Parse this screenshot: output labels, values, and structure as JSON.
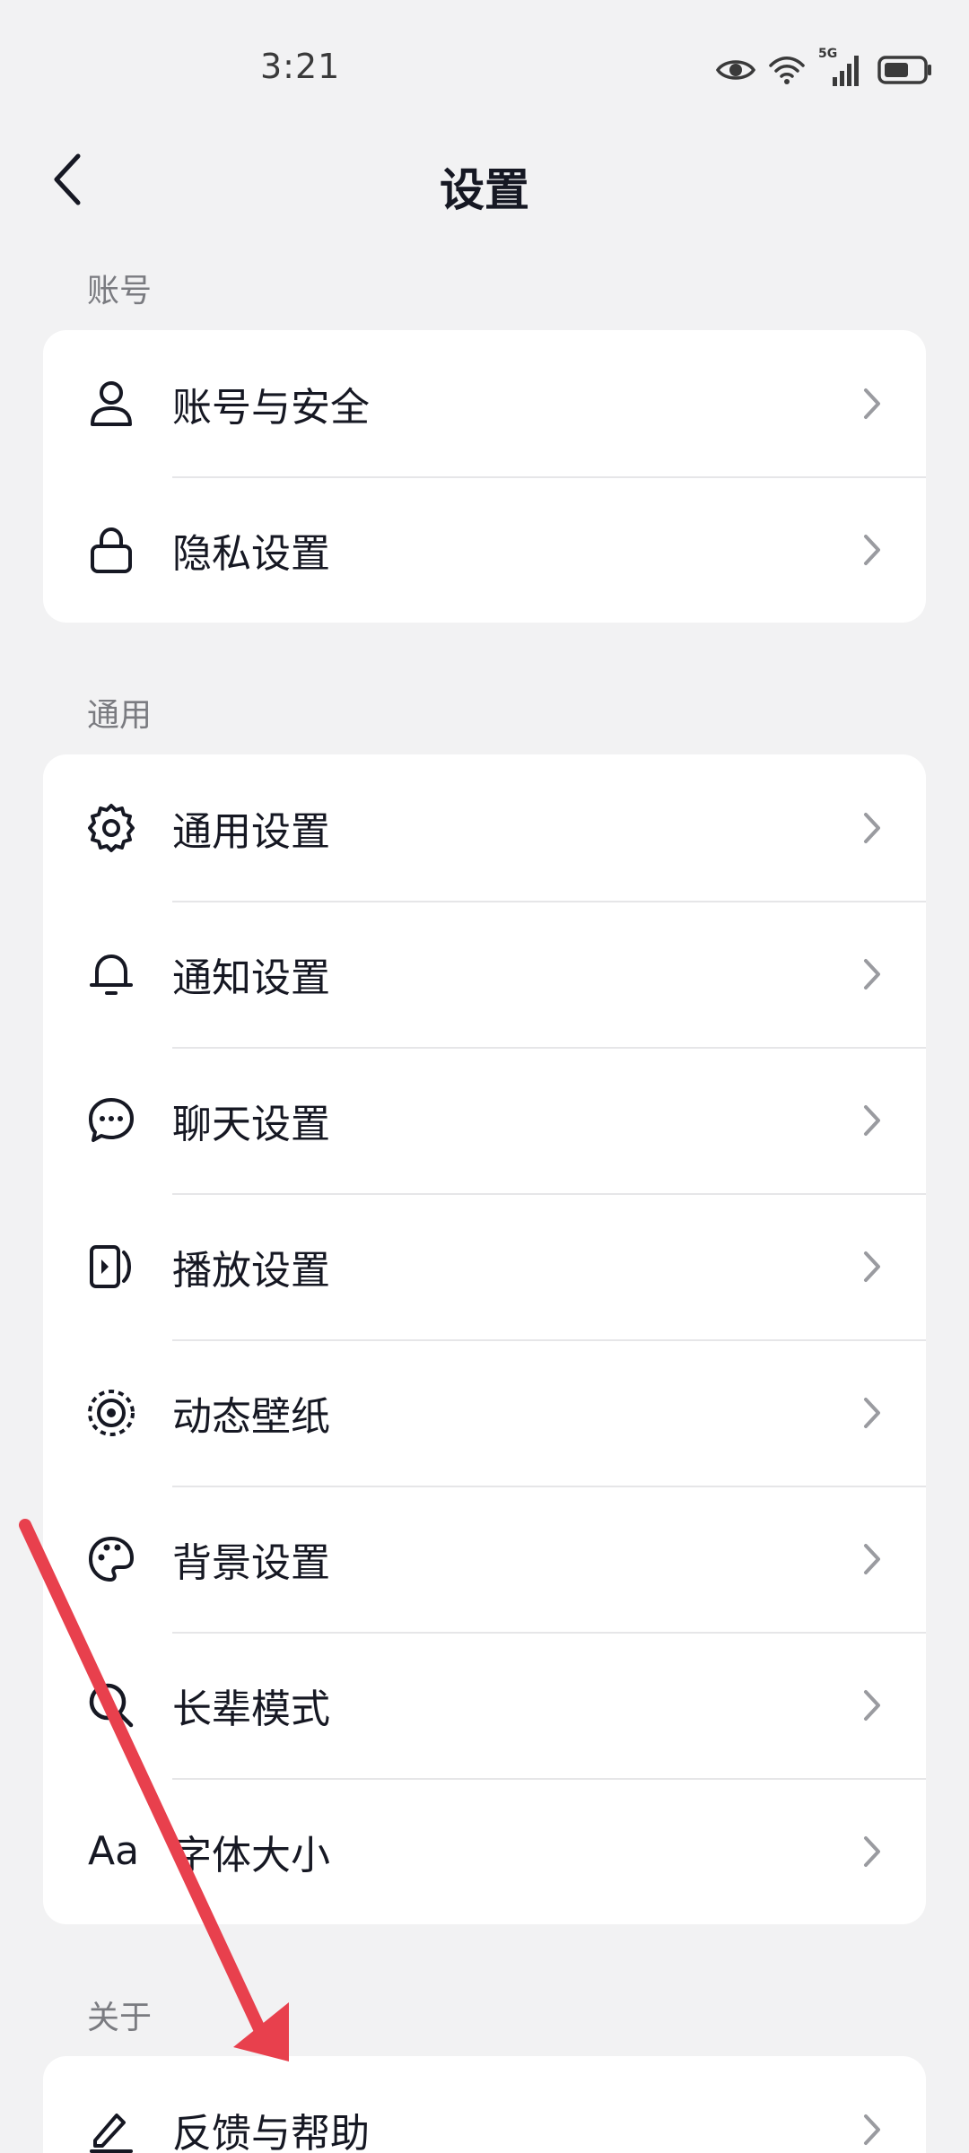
{
  "status_bar": {
    "time": "3:21",
    "network": "5G"
  },
  "nav": {
    "title": "设置"
  },
  "sections": [
    {
      "label": "账号",
      "items": [
        {
          "label": "账号与安全",
          "icon": "user-icon"
        },
        {
          "label": "隐私设置",
          "icon": "lock-icon"
        }
      ]
    },
    {
      "label": "通用",
      "items": [
        {
          "label": "通用设置",
          "icon": "gear-icon"
        },
        {
          "label": "通知设置",
          "icon": "bell-icon"
        },
        {
          "label": "聊天设置",
          "icon": "chat-bubble-icon"
        },
        {
          "label": "播放设置",
          "icon": "play-settings-icon"
        },
        {
          "label": "动态壁纸",
          "icon": "dynamic-wallpaper-icon"
        },
        {
          "label": "背景设置",
          "icon": "palette-icon"
        },
        {
          "label": "长辈模式",
          "icon": "search-magnifier-icon"
        },
        {
          "label": "字体大小",
          "icon": "font-size-icon",
          "icon_text": "Aa"
        }
      ]
    },
    {
      "label": "关于",
      "items": [
        {
          "label": "反馈与帮助",
          "icon": "pencil-icon"
        }
      ]
    }
  ],
  "colors": {
    "background": "#f2f2f3",
    "card": "#ffffff",
    "text": "#161823",
    "secondary_text": "#7a7b80",
    "chevron": "#9a9ba0",
    "annotation_arrow": "#e8404d"
  }
}
